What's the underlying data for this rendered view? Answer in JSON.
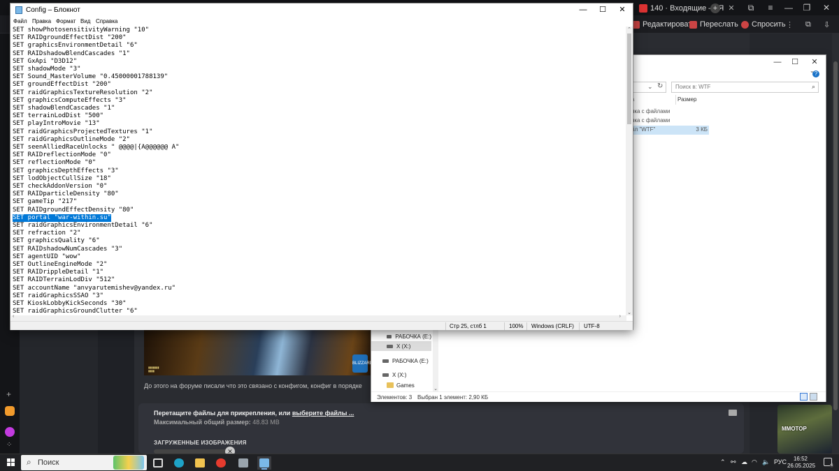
{
  "browser": {
    "tab_title": "140 · Входящие — Я",
    "toolbar": {
      "edit": "Редактировать",
      "forward": "Переслать",
      "ask": "Спросить"
    },
    "forum": {
      "post_text": "До этого на форуме писали что это связано с конфигом, конфиг в порядке",
      "attach_text": "Перетащите файлы для прикрепления, или",
      "attach_link": "выберите файлы ...",
      "max_size_label": "Максимальный общий размер:",
      "max_size_value": "48.83 MB",
      "uploaded_title": "ЗАГРУЖЕННЫЕ ИЗОБРАЖЕНИЯ",
      "image_logo": "BLIZZARD",
      "avatar_text": "ММОТОР"
    }
  },
  "explorer": {
    "search_placeholder": "Поиск в: WTF",
    "column_size": "Размер",
    "rows": [
      {
        "name": "пка с файлами",
        "size": ""
      },
      {
        "name": "пка с файлами",
        "size": ""
      },
      {
        "name": "йл \"WTF\"",
        "size": "3 КБ"
      }
    ],
    "nav": [
      "РАБОЧКА (E:)",
      "X (X:)",
      "РАБОЧКА (E:)",
      "X (X:)",
      "Games"
    ],
    "status_items": "Элементов: 3",
    "status_selected": "Выбран 1 элемент: 2,90 КБ"
  },
  "notepad": {
    "title": "Config – Блокнот",
    "menu": [
      "Файл",
      "Правка",
      "Формат",
      "Вид",
      "Справка"
    ],
    "lines": [
      "SET showPhotosensitivityWarning \"10\"",
      "SET RAIDgroundEffectDist \"200\"",
      "SET graphicsEnvironmentDetail \"6\"",
      "SET RAIDshadowBlendCascades \"1\"",
      "SET GxApi \"D3D12\"",
      "SET shadowMode \"3\"",
      "SET Sound_MasterVolume \"0.45000001788139\"",
      "SET groundEffectDist \"200\"",
      "SET raidGraphicsTextureResolution \"2\"",
      "SET graphicsComputeEffects \"3\"",
      "SET shadowBlendCascades \"1\"",
      "SET terrainLodDist \"500\"",
      "SET playIntroMovie \"13\"",
      "SET raidGraphicsProjectedTextures \"1\"",
      "SET raidGraphicsOutlineMode \"2\"",
      "SET seenAlliedRaceUnlocks \" @@@@|{A@@@@@@ A\"",
      "SET RAIDreflectionMode \"0\"",
      "SET reflectionMode \"0\"",
      "SET graphicsDepthEffects \"3\"",
      "SET lodObjectCullSize \"18\"",
      "SET checkAddonVersion \"0\"",
      "SET RAIDparticleDensity \"80\"",
      "SET gameTip \"217\"",
      "SET RAIDgroundEffectDensity \"80\"",
      "SET portal \"war-within.su\"",
      "SET raidGraphicsEnvironmentDetail \"6\"",
      "SET refraction \"2\"",
      "SET graphicsQuality \"6\"",
      "SET RAIDshadowNumCascades \"3\"",
      "SET agentUID \"wow\"",
      "SET OutlineEngineMode \"2\"",
      "SET RAIDrippleDetail \"1\"",
      "SET RAIDTerrainLodDiv \"512\"",
      "SET accountName \"anvyarutemishev@yandex.ru\"",
      "SET raidGraphicsSSAO \"3\"",
      "SET KioskLobbyKickSeconds \"30\"",
      "SET raidGraphicsGroundClutter \"6\""
    ],
    "selected_line": 24,
    "status": {
      "position": "Стр 25, стлб 1",
      "zoom": "100%",
      "eol": "Windows (CRLF)",
      "encoding": "UTF-8"
    }
  },
  "taskbar": {
    "search_placeholder": "Поиск",
    "language": "РУС",
    "time": "16:52",
    "date": "26.05.2025",
    "notifications": "4"
  }
}
